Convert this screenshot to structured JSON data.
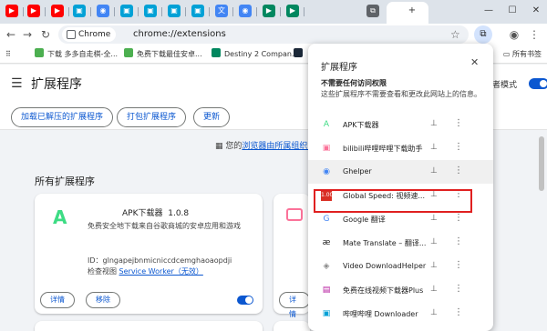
{
  "tabs": [
    {
      "icon": "youtube-icon",
      "color": "#ff0000"
    },
    {
      "icon": "youtube-icon",
      "color": "#ff0000"
    },
    {
      "icon": "youtube-icon",
      "color": "#ff0000"
    },
    {
      "icon": "bilibili-icon",
      "color": "#00a1d6"
    },
    {
      "icon": "chrome-icon",
      "color": "#4285f4"
    },
    {
      "icon": "bilibili-icon",
      "color": "#00a1d6"
    },
    {
      "icon": "bilibili-icon",
      "color": "#00a1d6"
    },
    {
      "icon": "bilibili-icon",
      "color": "#00a1d6"
    },
    {
      "icon": "bilibili-icon",
      "color": "#00a1d6"
    },
    {
      "icon": "translate-icon",
      "color": "#4285f4"
    },
    {
      "icon": "chrome-icon",
      "color": "#4285f4"
    },
    {
      "icon": "play-store-icon",
      "color": "#01875f"
    },
    {
      "icon": "play-store-icon",
      "color": "#01875f"
    },
    {
      "icon": "extension-icon",
      "color": "#5f6368"
    }
  ],
  "window": {
    "new_tab": "+",
    "minimize": "—",
    "maximize": "☐",
    "close": "✕"
  },
  "toolbar": {
    "chip_label": "Chrome",
    "url": "chrome://extensions"
  },
  "bookmarks": [
    {
      "label": "下载 多多自走棋-全...",
      "color": "#4caf50"
    },
    {
      "label": "免费下载最佳安卓...",
      "color": "#4caf50"
    },
    {
      "label": "Destiny 2 Compan...",
      "color": "#01875f"
    },
    {
      "label": "",
      "color": "#1b2838"
    }
  ],
  "bookmarks_right": "所有书签",
  "extensions_page": {
    "title": "扩展程序",
    "dev_mode_label": "者模式",
    "actions": [
      "加载已解压的扩展程序",
      "打包扩展程序",
      "更新"
    ],
    "notice_prefix": "您的",
    "notice_link": "浏览器由所属组织管",
    "section_title": "所有扩展程序",
    "card": {
      "name": "APK下载器",
      "version": "1.0.8",
      "description": "免费安全地下载来自谷歌商城的安卓应用和游戏",
      "id": "ID：glngapejbnmicniccdcemghaoaopdji",
      "inspect_prefix": "检查视图",
      "inspect_link": "Service Worker（无效）",
      "details_label": "详情",
      "remove_label": "移除",
      "enabled": true
    },
    "card2": {
      "details_label": "详情"
    }
  },
  "popup": {
    "title": "扩展程序",
    "close": "✕",
    "no_access_title": "不需要任何访问权限",
    "no_access_desc": "这些扩展程序不需要查看和更改此网站上的信息。",
    "items": [
      {
        "name": "APK下载器",
        "icon": "android-a-icon",
        "color": "#3ddc84"
      },
      {
        "name": "bilibili哔哩哔哩下载助手",
        "icon": "bilibili-icon",
        "color": "#fb7299"
      },
      {
        "name": "Ghelper",
        "icon": "chrome-icon",
        "color": "#4285f4"
      },
      {
        "name": "Global Speed: 视频速...",
        "icon": "speed-icon",
        "color": "#d93025"
      },
      {
        "name": "Google 翻译",
        "icon": "translate-icon",
        "color": "#4285f4"
      },
      {
        "name": "Mate Translate – 翻译...",
        "icon": "mate-icon",
        "color": "#222222"
      },
      {
        "name": "Video DownloadHelper",
        "icon": "video-helper-icon",
        "color": "#888888"
      },
      {
        "name": "免费在线视频下载器Plus",
        "icon": "film-icon",
        "color": "#b5179e"
      },
      {
        "name": "哔哩哔哩 Downloader",
        "icon": "bilibili-icon",
        "color": "#00a1d6"
      }
    ]
  }
}
